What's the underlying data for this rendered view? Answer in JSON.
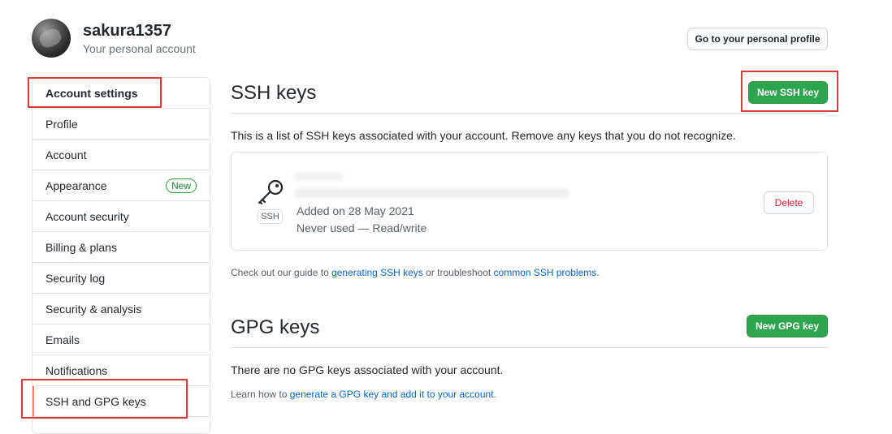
{
  "header": {
    "username": "sakura1357",
    "subtitle": "Your personal account",
    "profile_button": "Go to your personal profile"
  },
  "sidebar": {
    "title": "Account settings",
    "items": [
      {
        "label": "Profile"
      },
      {
        "label": "Account"
      },
      {
        "label": "Appearance",
        "badge": "New"
      },
      {
        "label": "Account security"
      },
      {
        "label": "Billing & plans"
      },
      {
        "label": "Security log"
      },
      {
        "label": "Security & analysis"
      },
      {
        "label": "Emails"
      },
      {
        "label": "Notifications"
      },
      {
        "label": "SSH and GPG keys",
        "selected": true
      }
    ]
  },
  "ssh": {
    "title": "SSH keys",
    "new_button": "New SSH key",
    "description": "This is a list of SSH keys associated with your account. Remove any keys that you do not recognize.",
    "key": {
      "tag": "SSH",
      "added": "Added on 28 May 2021",
      "usage": "Never used — Read/write",
      "delete_button": "Delete"
    },
    "guide": {
      "prefix": "Check out our guide to ",
      "link1": "generating SSH keys",
      "middle": " or troubleshoot ",
      "link2": "common SSH problems",
      "suffix": "."
    }
  },
  "gpg": {
    "title": "GPG keys",
    "new_button": "New GPG key",
    "empty": "There are no GPG keys associated with your account.",
    "learn": {
      "prefix": "Learn how to ",
      "link": "generate a GPG key and add it to your account",
      "suffix": "."
    }
  },
  "colors": {
    "primary_green": "#2ea44f",
    "link_blue": "#0366d6",
    "danger_red": "#cb2431",
    "highlight_red": "#d93b3b"
  }
}
